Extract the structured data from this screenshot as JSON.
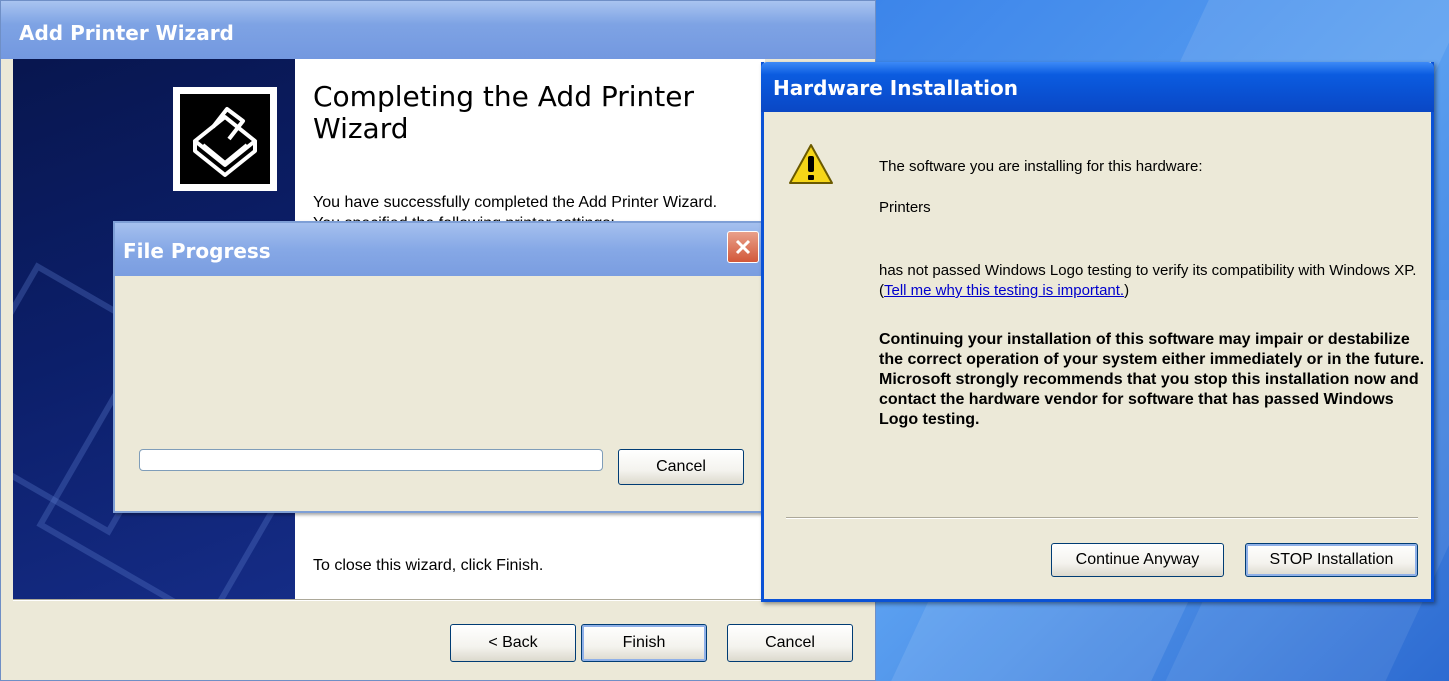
{
  "wizard": {
    "title": "Add Printer Wizard",
    "heading": "Completing the Add Printer Wizard",
    "text1": "You have successfully completed the Add Printer Wizard.",
    "text2": "You specified the following printer settings:",
    "close_text": "To close this wizard, click Finish.",
    "buttons": {
      "back": "< Back",
      "finish": "Finish",
      "cancel": "Cancel"
    }
  },
  "file_progress": {
    "title": "File Progress",
    "cancel": "Cancel",
    "progress": 0
  },
  "hardware": {
    "title": "Hardware Installation",
    "line1": "The software you are installing for this hardware:",
    "line2": "Printers",
    "para_before": "has not passed Windows Logo testing to verify its compatibility with Windows XP. (",
    "link": "Tell me why this testing is important.",
    "para_after": ")",
    "bold": "Continuing your installation of this software may impair or destabilize the correct operation of your system either immediately or in the future. Microsoft strongly recommends that you stop this installation now and contact the hardware vendor for software that has passed Windows Logo testing.",
    "buttons": {
      "continue": "Continue Anyway",
      "stop": "STOP Installation"
    }
  }
}
